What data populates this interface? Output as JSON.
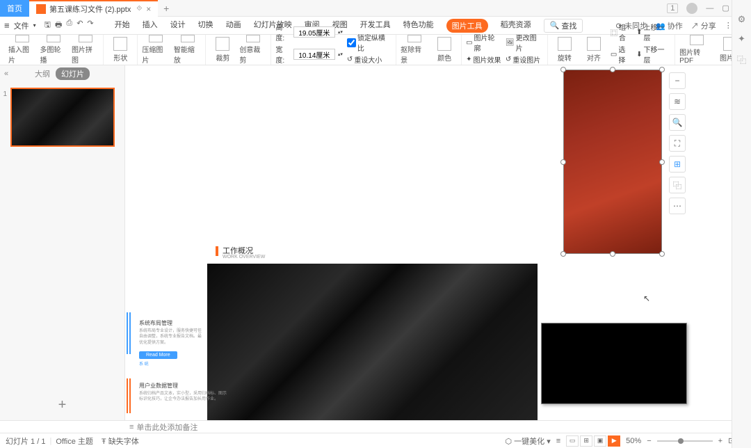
{
  "titlebar": {
    "home_tab": "首页",
    "file_tab": "第五课练习文件 (2).pptx",
    "window_num": "1"
  },
  "menubar": {
    "file": "文件",
    "tabs": [
      "开始",
      "插入",
      "设计",
      "切换",
      "动画",
      "幻灯片放映",
      "审阅",
      "视图",
      "开发工具",
      "特色功能"
    ],
    "active_tab": "图片工具",
    "extra_tab": "稻壳资源",
    "search": "查找",
    "unsync": "未同步",
    "collab": "协作",
    "share": "分享"
  },
  "ribbon": {
    "items": [
      "插入图片",
      "多图轮播",
      "图片拼图",
      "形状",
      "压缩图片",
      "智能缩放",
      "裁剪",
      "创意裁剪"
    ],
    "height_lbl": "高度:",
    "height_val": "19.05厘米",
    "width_lbl": "宽度:",
    "width_val": "10.14厘米",
    "lock_ratio": "锁定纵横比",
    "reset_size": "重设大小",
    "items2": [
      "抠除背景",
      "颜色",
      "图片轮廓",
      "图片效果",
      "更改图片",
      "重设图片",
      "旋转",
      "对齐",
      "组合",
      "选择",
      "上移一层",
      "下移一层",
      "图片转PDF",
      "图片翻"
    ]
  },
  "sidebar": {
    "outline": "大纲",
    "slides": "幻灯片"
  },
  "slide": {
    "work_title": "工作概况",
    "work_sub": "WORK OVERVIEW",
    "block1_title": "系统布局管理",
    "block1_body": "系统布局专业设计，服务快捷可任\n自由调整，系统专业报告文档。最\n优化提供方案。",
    "readmore": "Read More",
    "barcap": "系 统",
    "block2_title": "用户业数据管理",
    "block2_body": "系统归档产品文本，实小型，采用归档标、图示\n标识化技巧，让企今办法报告加长用作业。"
  },
  "notes": {
    "placeholder": "单击此处添加备注"
  },
  "statusbar": {
    "slide": "幻灯片 1 / 1",
    "theme": "Office 主题",
    "font": "缺失字体",
    "beautify": "一键美化",
    "zoom": "50%"
  }
}
